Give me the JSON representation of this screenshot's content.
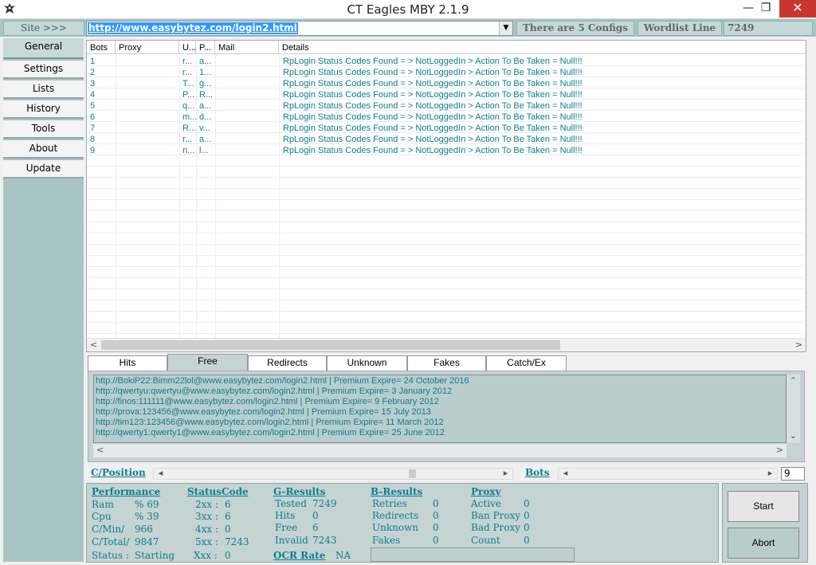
{
  "window": {
    "title": "CT Eagles MBY 2.1.9",
    "min": "—",
    "max": "❐",
    "close": "✕"
  },
  "topbar": {
    "site_label": "Site >>>",
    "url": "http://www.easybytez.com/login2.html",
    "configs": "There are 5 Configs",
    "wordlist_label": "Wordlist Line",
    "wordlist_value": "7249"
  },
  "sidebar": {
    "items": [
      {
        "label": "General"
      },
      {
        "label": "Settings"
      },
      {
        "label": "Lists"
      },
      {
        "label": "History"
      },
      {
        "label": "Tools"
      },
      {
        "label": "About"
      },
      {
        "label": "Update"
      }
    ]
  },
  "grid": {
    "headers": [
      "Bots",
      "Proxy",
      "U...",
      "P...",
      "Mail",
      "Details"
    ],
    "rows": [
      {
        "bot": "1",
        "proxy": "",
        "u": "r...",
        "p": "a...",
        "mail": "",
        "details": "RpLogin Status Codes Found =  > NotLoggedIn >  Action To Be Taken = Null!!!"
      },
      {
        "bot": "2",
        "proxy": "",
        "u": "r...",
        "p": "1...",
        "mail": "",
        "details": "RpLogin Status Codes Found =  > NotLoggedIn >  Action To Be Taken = Null!!!"
      },
      {
        "bot": "3",
        "proxy": "",
        "u": "T...",
        "p": "g...",
        "mail": "",
        "details": "RpLogin Status Codes Found =  > NotLoggedIn >  Action To Be Taken = Null!!!"
      },
      {
        "bot": "4",
        "proxy": "",
        "u": "P...",
        "p": "R...",
        "mail": "",
        "details": "RpLogin Status Codes Found =  > NotLoggedIn >  Action To Be Taken = Null!!!"
      },
      {
        "bot": "5",
        "proxy": "",
        "u": "q...",
        "p": "a...",
        "mail": "",
        "details": "RpLogin Status Codes Found =  > NotLoggedIn >  Action To Be Taken = Null!!!"
      },
      {
        "bot": "6",
        "proxy": "",
        "u": "m...",
        "p": "d...",
        "mail": "",
        "details": "RpLogin Status Codes Found =  > NotLoggedIn >  Action To Be Taken = Null!!!"
      },
      {
        "bot": "7",
        "proxy": "",
        "u": "R...",
        "p": "v...",
        "mail": "",
        "details": "RpLogin Status Codes Found =  > NotLoggedIn >  Action To Be Taken = Null!!!"
      },
      {
        "bot": "8",
        "proxy": "",
        "u": "r...",
        "p": "a...",
        "mail": "",
        "details": "RpLogin Status Codes Found =  > NotLoggedIn >  Action To Be Taken = Null!!!"
      },
      {
        "bot": "9",
        "proxy": "",
        "u": "n...",
        "p": "l...",
        "mail": "",
        "details": "RpLogin Status Codes Found =  > NotLoggedIn >  Action To Be Taken = Null!!!"
      }
    ]
  },
  "tabs": [
    {
      "label": "Hits"
    },
    {
      "label": "Free"
    },
    {
      "label": "Redirects"
    },
    {
      "label": "Unknown"
    },
    {
      "label": "Fakes"
    },
    {
      "label": "Catch/Ex"
    }
  ],
  "results": [
    "http://BokiP22:Bimm22lol@www.easybytez.com/login2.html | Premium Expire= 24 October 2016",
    "http://qwertyu:qwertyu@www.easybytez.com/login2.html | Premium Expire= 3 January 2012",
    "http://finos:111111@www.easybytez.com/login2.html | Premium Expire= 9 February 2012",
    "http://prova:123456@www.easybytez.com/login2.html | Premium Expire= 15 July 2013",
    "http://tim123:123456@www.easybytez.com/login2.html | Premium Expire= 11 March 2012",
    "http://qwerty1:qwerty1@www.easybytez.com/login2.html | Premium Expire= 25 June 2012"
  ],
  "position": {
    "cpos_label": "C/Position",
    "bots_label": "Bots",
    "bots_value": "9"
  },
  "stats": {
    "performance": {
      "title": "Performance",
      "ram_label": "Ram",
      "ram_value": "% 69",
      "cpu_label": "Cpu",
      "cpu_value": "% 39",
      "cmin_label": "C/Min/",
      "cmin_value": "966",
      "ctotal_label": "C/Total/",
      "ctotal_value": "9847",
      "status_label": "Status :",
      "status_value": "Starting"
    },
    "statuscode": {
      "title": "StatusCode",
      "c2_label": "2xx :",
      "c2_value": "6",
      "c3_label": "3xx :",
      "c3_value": "6",
      "c4_label": "4xx :",
      "c4_value": "0",
      "c5_label": "5xx :",
      "c5_value": "7243",
      "cx_label": "Xxx :",
      "cx_value": "0"
    },
    "g_results": {
      "title": "G-Results",
      "tested_label": "Tested",
      "tested_value": "7249",
      "hits_label": "Hits",
      "hits_value": "0",
      "free_label": "Free",
      "free_value": "6",
      "invalid_label": "Invalid",
      "invalid_value": "7243"
    },
    "ocr": {
      "label": "OCR Rate",
      "value": "NA"
    },
    "b_results": {
      "title": "B-Results",
      "retries_label": "Retries",
      "retries_value": "0",
      "redirects_label": "Redirects",
      "redirects_value": "0",
      "unknown_label": "Unknown",
      "unknown_value": "0",
      "fakes_label": "Fakes",
      "fakes_value": "0"
    },
    "proxy": {
      "title": "Proxy",
      "active_label": "Active",
      "active_value": "0",
      "ban_label": "Ban Proxy",
      "ban_value": "0",
      "bad_label": "Bad Proxy",
      "bad_value": "0",
      "count_label": "Count",
      "count_value": "0"
    }
  },
  "controls": {
    "start_label": "Start",
    "abort_label": "Abort"
  },
  "colors": {
    "accent": "#0a7f8f",
    "panel": "#c5d3d3",
    "topbar": "#a9c4c4",
    "close": "#c7372f"
  }
}
